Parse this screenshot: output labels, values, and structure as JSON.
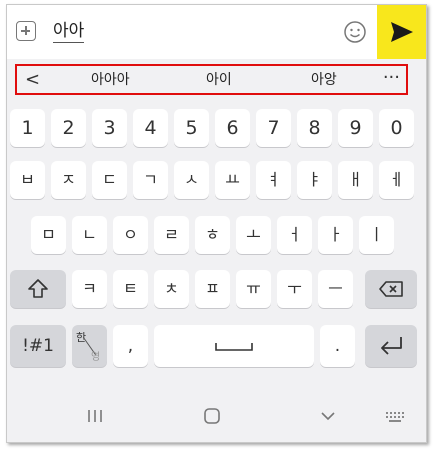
{
  "input": {
    "typed_text": "아아"
  },
  "suggestions": {
    "back": "<",
    "items": [
      "아아아",
      "아이",
      "아앙"
    ],
    "more": "···"
  },
  "keyboard": {
    "row_numbers": [
      "1",
      "2",
      "3",
      "4",
      "5",
      "6",
      "7",
      "8",
      "9",
      "0"
    ],
    "row1": [
      "ㅂ",
      "ㅈ",
      "ㄷ",
      "ㄱ",
      "ㅅ",
      "ㅛ",
      "ㅕ",
      "ㅑ",
      "ㅐ",
      "ㅔ"
    ],
    "row2": [
      "ㅁ",
      "ㄴ",
      "ㅇ",
      "ㄹ",
      "ㅎ",
      "ㅗ",
      "ㅓ",
      "ㅏ",
      "ㅣ"
    ],
    "row3": [
      "ㅋ",
      "ㅌ",
      "ㅊ",
      "ㅍ",
      "ㅠ",
      "ㅜ",
      "ㅡ"
    ],
    "symbols_label": "!#1",
    "lang_label_top": "한",
    "lang_label_bottom": "영",
    "comma": ",",
    "period": "."
  },
  "colors": {
    "send_background": "#f8e71c",
    "highlight_border": "#e00d0d",
    "keyboard_background": "#f1f1f3"
  },
  "icons": [
    "plus-icon",
    "emoji-icon",
    "send-icon",
    "shift-icon",
    "backspace-icon",
    "enter-icon",
    "space-icon",
    "recent-apps-icon",
    "home-icon",
    "back-chevron-icon",
    "keyboard-icon"
  ]
}
